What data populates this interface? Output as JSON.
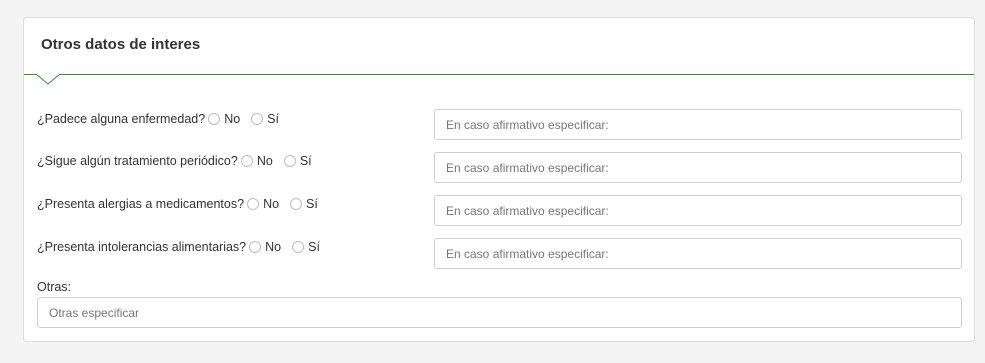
{
  "panel": {
    "title": "Otros datos de interes",
    "accent_color": "#3a8a4b"
  },
  "questions": [
    {
      "label": "¿Padece alguna enfermedad?",
      "option_no": "No",
      "option_si": "Sí",
      "specify_placeholder": "En caso afirmativo especificar:"
    },
    {
      "label": "¿Sigue algún tratamiento periódico?",
      "option_no": "No",
      "option_si": "Sí",
      "specify_placeholder": "En caso afirmativo especificar:"
    },
    {
      "label": "¿Presenta alergias a medicamentos?",
      "option_no": "No",
      "option_si": "Sí",
      "specify_placeholder": "En caso afirmativo especificar:"
    },
    {
      "label": "¿Presenta intolerancias alimentarias?",
      "option_no": "No",
      "option_si": "Sí",
      "specify_placeholder": "En caso afirmativo especificar:"
    }
  ],
  "otras": {
    "label": "Otras:",
    "placeholder": "Otras especificar"
  }
}
